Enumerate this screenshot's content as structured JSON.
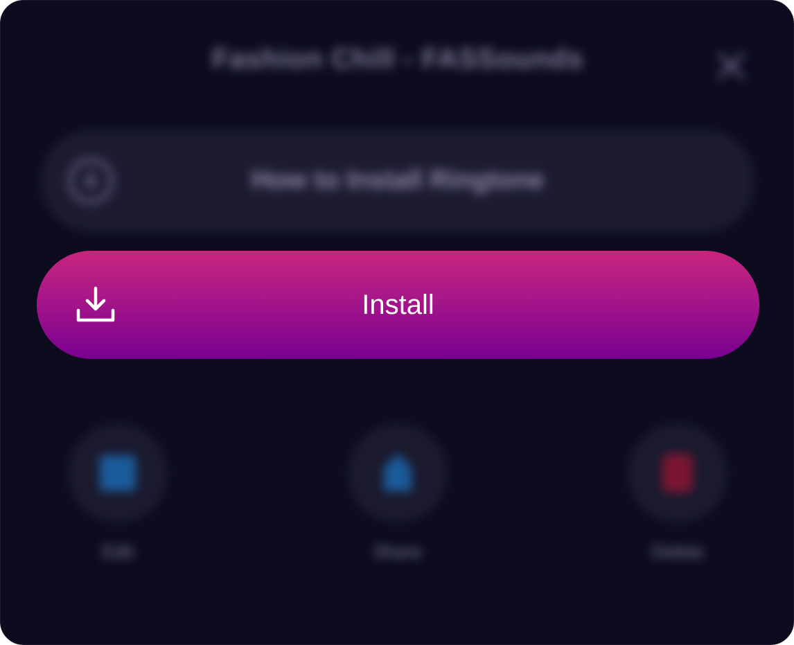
{
  "sheet": {
    "title": "Fashion Chill - FASSounds",
    "close_label": "×"
  },
  "guide": {
    "label": "How to Install Ringtone",
    "icon": "download-circle-icon"
  },
  "install": {
    "label": "Install",
    "icon": "download-icon"
  },
  "actions": [
    {
      "label": "Edit",
      "icon": "edit-icon",
      "color": "#1b5a9a"
    },
    {
      "label": "Share",
      "icon": "share-icon",
      "color": "#1b5a9a"
    },
    {
      "label": "Delete",
      "icon": "trash-icon",
      "color": "#7a1632"
    }
  ],
  "colors": {
    "background": "#0d0c1f",
    "install_gradient_top": "#c8267d",
    "install_gradient_bottom": "#78008f"
  }
}
